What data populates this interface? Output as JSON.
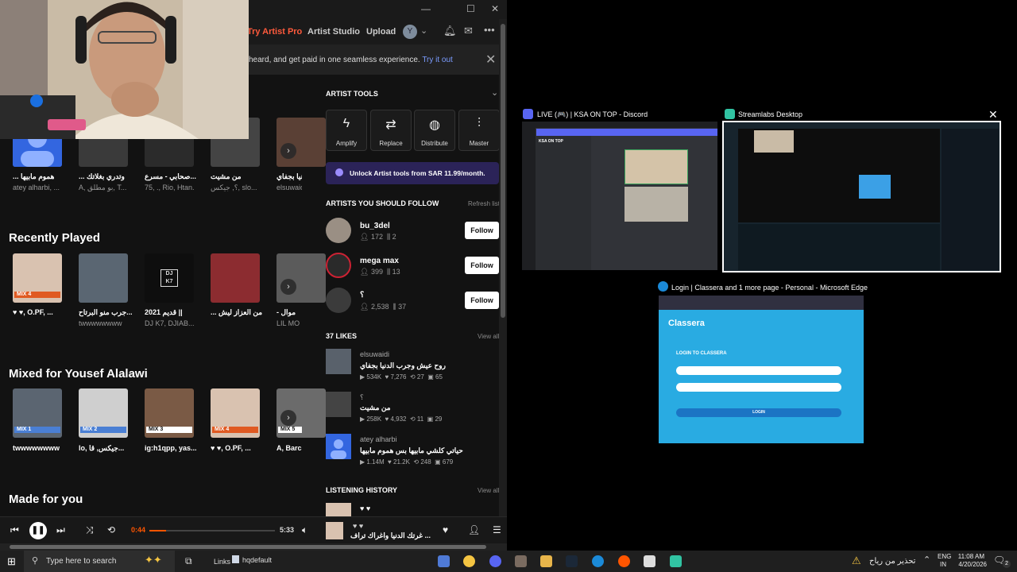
{
  "soundcloud": {
    "header": {
      "try_pro": "Try Artist Pro",
      "artist_studio": "Artist Studio",
      "upload": "Upload",
      "avatar_initial": "Y"
    },
    "banner": {
      "text": "heard, and get paid in one seamless experience.",
      "link": "Try it out"
    },
    "top_row": [
      {
        "label": "... هموم مابيها",
        "sub": "atey alharbi, ..."
      },
      {
        "label": "... وتدري بغلاتك",
        "sub": "A, بو مطلق, T..."
      },
      {
        "label": "صحابي - مسرع...",
        "sub": "75, ., Rio, Htan."
      },
      {
        "label": "من مشيت",
        "sub": "؟, جيكس, slo..."
      },
      {
        "label": "روح عيش وجرب الدنيا بجفاي",
        "sub": "elsuwaidi"
      }
    ],
    "recently_played": {
      "title": "Recently Played",
      "items": [
        {
          "label": "♥ ♥, O.PF, ...",
          "sub": "",
          "tag": "MIX 4"
        },
        {
          "label": "جرب منو البرتاح...",
          "sub": "twwwwwwww",
          "tag": ""
        },
        {
          "label": "2021 قديم ||",
          "sub": "DJ K7, DJIAB...",
          "tag": ""
        },
        {
          "label": "... من العزاز ليش",
          "sub": "",
          "tag": ""
        },
        {
          "label": "- موال",
          "sub": "LIL MO",
          "tag": ""
        }
      ],
      "dj_logo": "DJ\nK7"
    },
    "mixed_for": {
      "title": "Mixed for Yousef Alalawi",
      "items": [
        {
          "label": "twwwwwwww",
          "tag": "MIX 1"
        },
        {
          "label": "lo, جيكس, قا...",
          "tag": "MIX 2"
        },
        {
          "label": "ig:h1qpp, yas...",
          "tag": "MIX 3"
        },
        {
          "label": "♥ ♥, O.PF, ...",
          "tag": "MIX 4"
        },
        {
          "label": "A, Barc",
          "tag": "MIX 5"
        }
      ]
    },
    "made_for_you": "Made for you",
    "sidebar": {
      "artist_tools": "ARTIST TOOLS",
      "tools": [
        "Amplify",
        "Replace",
        "Distribute",
        "Master"
      ],
      "unlock": "Unlock Artist tools from SAR 11.99/month.",
      "follow_title": "ARTISTS YOU SHOULD FOLLOW",
      "refresh": "Refresh list",
      "follow_label": "Follow",
      "artists": [
        {
          "name": "bu_3del",
          "followers": "172",
          "tracks": "2"
        },
        {
          "name": "mega max",
          "followers": "399",
          "tracks": "13"
        },
        {
          "name": "؟",
          "followers": "2,538",
          "tracks": "37"
        }
      ],
      "likes_title": "37 LIKES",
      "view_all": "View all",
      "likes": [
        {
          "artist": "elsuwaidi",
          "title": "روح عيش وجرب الدنيا بجفاي",
          "plays": "534K",
          "hearts": "7,276",
          "reposts": "27",
          "comments": "65"
        },
        {
          "artist": "؟",
          "title": "من مشيت",
          "plays": "258K",
          "hearts": "4,932",
          "reposts": "11",
          "comments": "29"
        },
        {
          "artist": "atey alharbi",
          "title": "حياتي كلشي مابيها بس هموم مابيها",
          "plays": "1.14M",
          "hearts": "21.2K",
          "reposts": "248",
          "comments": "679"
        }
      ],
      "history_title": "LISTENING HISTORY",
      "history_first": "♥ ♥"
    },
    "player": {
      "elapsed": "0:44",
      "duration": "5:33",
      "progress": 0.13,
      "now_artist": "♥ ♥",
      "now_title": "غرتك الدنيا واغراك تراف ..."
    }
  },
  "task_view": {
    "discord_title": "LIVE (🎮) | KSA ON TOP - Discord",
    "streamlabs_title": "Streamlabs Desktop",
    "edge_title": "Login | Classera and 1 more page - Personal - Microsoft Edge",
    "discord_server": "KSA ON TOP",
    "classera": {
      "brand": "Classera",
      "login_heading": "LOGIN TO CLASSERA",
      "login_button": "LOGIN"
    }
  },
  "taskbar": {
    "search_placeholder": "Type here to search",
    "links": "Links",
    "hqdefault": "hqdefault",
    "warning": "تحذير من رياح",
    "lang1": "ENG",
    "lang2": "IN",
    "time": "11:08 AM",
    "date": "4/20/2026",
    "notif_count": "2"
  }
}
